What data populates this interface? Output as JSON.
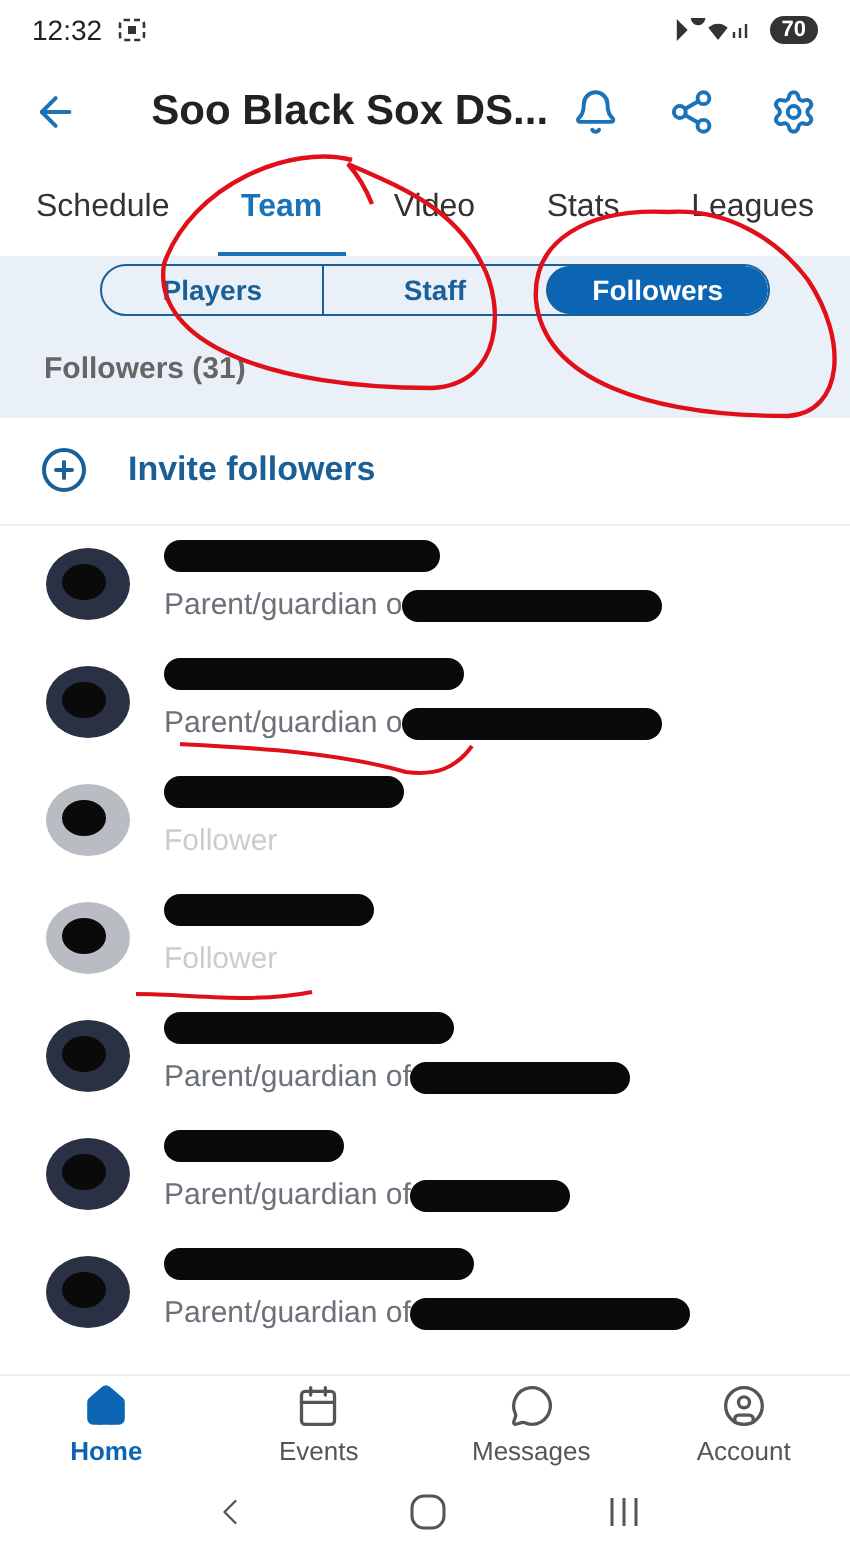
{
  "status_bar": {
    "time": "12:32",
    "battery": "70"
  },
  "header": {
    "title": "Soo Black Sox DS..."
  },
  "tabs": [
    {
      "label": "Schedule",
      "selected": false
    },
    {
      "label": "Team",
      "selected": true
    },
    {
      "label": "Video",
      "selected": false
    },
    {
      "label": "Stats",
      "selected": false
    },
    {
      "label": "Leagues",
      "selected": false
    }
  ],
  "segments": [
    {
      "label": "Players",
      "selected": false
    },
    {
      "label": "Staff",
      "selected": false
    },
    {
      "label": "Followers",
      "selected": true
    }
  ],
  "section_title": "Followers (31)",
  "invite": {
    "label": "Invite followers"
  },
  "followers": [
    {
      "kind": "guardian",
      "subtitle": "Parent/guardian o"
    },
    {
      "kind": "guardian",
      "subtitle": "Parent/guardian o"
    },
    {
      "kind": "follower",
      "subtitle": "Follower"
    },
    {
      "kind": "follower",
      "subtitle": "Follower"
    },
    {
      "kind": "guardian",
      "subtitle": "Parent/guardian of"
    },
    {
      "kind": "guardian",
      "subtitle": "Parent/guardian of"
    },
    {
      "kind": "guardian",
      "subtitle": "Parent/guardian of"
    }
  ],
  "bottom_nav": [
    {
      "label": "Home",
      "selected": true
    },
    {
      "label": "Events",
      "selected": false
    },
    {
      "label": "Messages",
      "selected": false
    },
    {
      "label": "Account",
      "selected": false
    }
  ]
}
